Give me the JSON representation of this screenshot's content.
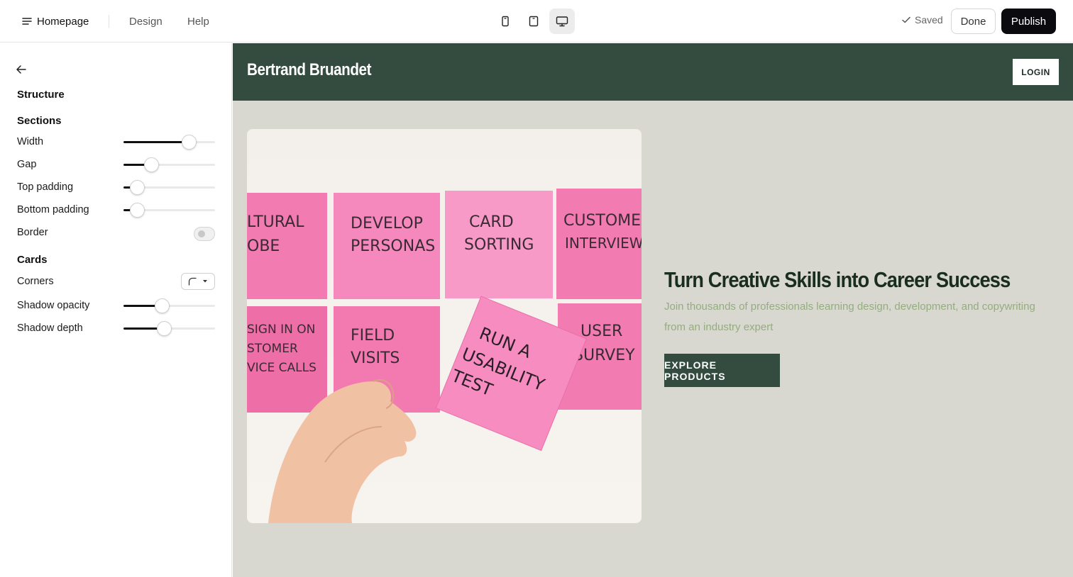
{
  "topbar": {
    "page_name": "Homepage",
    "nav": [
      "Design",
      "Help"
    ],
    "device_icons": [
      "mobile-icon",
      "tablet-icon",
      "desktop-icon"
    ],
    "active_device": "desktop",
    "saved_label": "Saved",
    "done_label": "Done",
    "publish_label": "Publish"
  },
  "sidebar": {
    "heading": "Structure",
    "sections_heading": "Sections",
    "width_label": "Width",
    "width_value": 0.71,
    "gap_label": "Gap",
    "gap_value": 0.3,
    "top_padding_label": "Top padding",
    "top_padding_value": 0.15,
    "bottom_padding_label": "Bottom padding",
    "bottom_padding_value": 0.15,
    "border_label": "Border",
    "border_on": false,
    "cards_heading": "Cards",
    "corners_label": "Corners",
    "shadow_opacity_label": "Shadow opacity",
    "shadow_opacity_value": 0.42,
    "shadow_depth_label": "Shadow depth",
    "shadow_depth_value": 0.44
  },
  "preview": {
    "site_name": "Bertrand Bruandet",
    "login_label": "LOGIN",
    "hero_title": "Turn Creative Skills into Career Success",
    "hero_subtitle": "Join thousands of professionals learning design, development, and copywriting from an industry expert",
    "cta_label": "EXPLORE PRODUCTS",
    "image_notes": [
      "LTURAL",
      "OBE",
      "DEVELOP",
      "PERSONAS",
      "CARD",
      "SORTING",
      "CUSTOME",
      "INTERVIEW",
      "SIGN IN ON",
      "STOMER",
      "VICE CALLS",
      "FIELD",
      "VISITS",
      "RUN A",
      "USABILITY",
      "TEST",
      "USER",
      "SURVEY"
    ]
  },
  "colors": {
    "header_green": "#344c40",
    "canvas_bg": "#d9d8d0",
    "title_green": "#1a2e1d",
    "subtitle_green": "#93ad7e",
    "publish_bg": "#0b0b0f"
  }
}
